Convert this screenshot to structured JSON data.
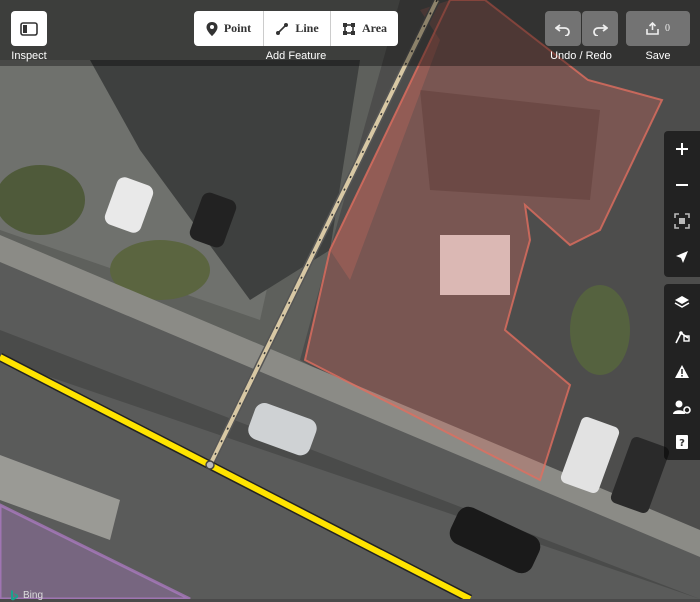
{
  "toolbar": {
    "inspect_label": "Inspect",
    "add_feature_label": "Add Feature",
    "point_label": "Point",
    "line_label": "Line",
    "area_label": "Area",
    "undo_redo_label": "Undo / Redo",
    "save_label": "Save",
    "save_count": "0"
  },
  "map_controls": {
    "zoom": [
      "zoom-in",
      "zoom-out",
      "zoom-to-selection",
      "geolocate"
    ],
    "panels": [
      "background-layers",
      "map-data",
      "issues",
      "preferences",
      "help"
    ]
  },
  "attribution": {
    "imagery_provider": "Bing"
  },
  "colors": {
    "road_highlight": "#ffe400",
    "building_area": "#e06e5f",
    "path_line": "#d8c8a4",
    "purple_area": "#b07cc8"
  }
}
